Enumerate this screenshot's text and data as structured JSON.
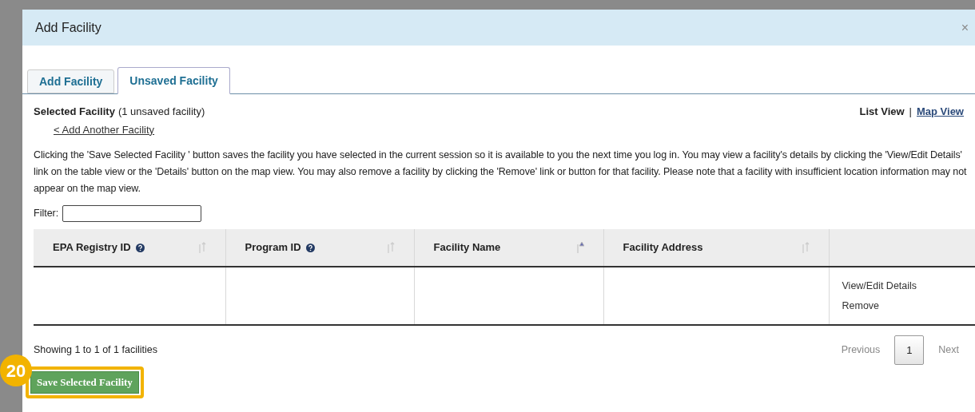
{
  "window": {
    "title": "Add Facility",
    "close": "×"
  },
  "tabs": [
    {
      "label": "Add Facility",
      "selected": false
    },
    {
      "label": "Unsaved Facility",
      "selected": true
    }
  ],
  "header": {
    "title": "Selected Facility",
    "count": "(1 unsaved facility)",
    "back_link": "< Add Another Facility",
    "views": [
      {
        "label": "List View",
        "selected": true
      },
      {
        "label": "Map View",
        "selected": false
      }
    ],
    "separator": "|"
  },
  "description": "Clicking the 'Save Selected Facility ' button saves the facility you have selected in the current session so it is available to you the next time you log in. You may view a facility's details by clicking the 'View/Edit Details' link on the table view or the 'Details' button on the map view. You may also remove a facility by clicking the 'Remove' link or button for that facility. Please note that a facility with insufficient location information may not appear on the map view.",
  "filter": {
    "label": "Filter:"
  },
  "table": {
    "columns": [
      {
        "label": "EPA Registry ID",
        "help": true,
        "sorted": false
      },
      {
        "label": "Program ID",
        "help": true,
        "sorted": false
      },
      {
        "label": "Facility Name",
        "help": false,
        "sorted": true
      },
      {
        "label": "Facility Address",
        "help": false,
        "sorted": false
      }
    ],
    "rows": [
      {
        "actions": [
          "View/Edit Details",
          "Remove"
        ]
      }
    ]
  },
  "footer": {
    "info": "Showing 1 to 1 of 1 facilities",
    "previous": "Previous",
    "pages": [
      {
        "label": "1",
        "selected": true
      }
    ],
    "next": "Next"
  },
  "save_button": "Save Selected Facility",
  "callout": {
    "number": "20"
  }
}
